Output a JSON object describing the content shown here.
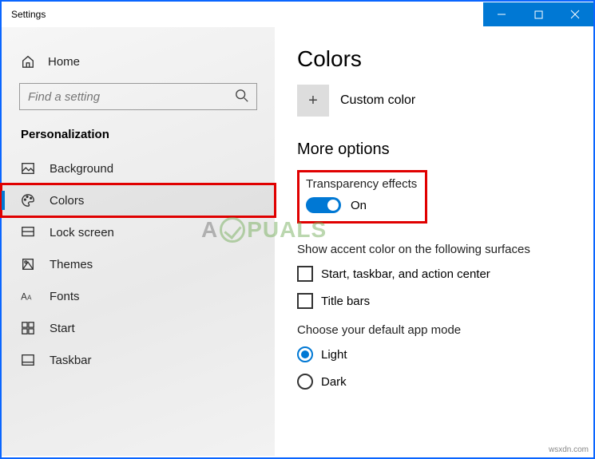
{
  "window": {
    "title": "Settings"
  },
  "sidebar": {
    "home": "Home",
    "search_placeholder": "Find a setting",
    "category": "Personalization",
    "items": [
      {
        "label": "Background"
      },
      {
        "label": "Colors"
      },
      {
        "label": "Lock screen"
      },
      {
        "label": "Themes"
      },
      {
        "label": "Fonts"
      },
      {
        "label": "Start"
      },
      {
        "label": "Taskbar"
      }
    ]
  },
  "main": {
    "title": "Colors",
    "custom_color": "Custom color",
    "more_options": "More options",
    "transparency": {
      "label": "Transparency effects",
      "state": "On"
    },
    "accent_heading": "Show accent color on the following surfaces",
    "accent_opts": [
      "Start, taskbar, and action center",
      "Title bars"
    ],
    "mode_heading": "Choose your default app mode",
    "modes": [
      "Light",
      "Dark"
    ]
  },
  "credit": "wsxdn.com",
  "watermark": "A PUALS"
}
